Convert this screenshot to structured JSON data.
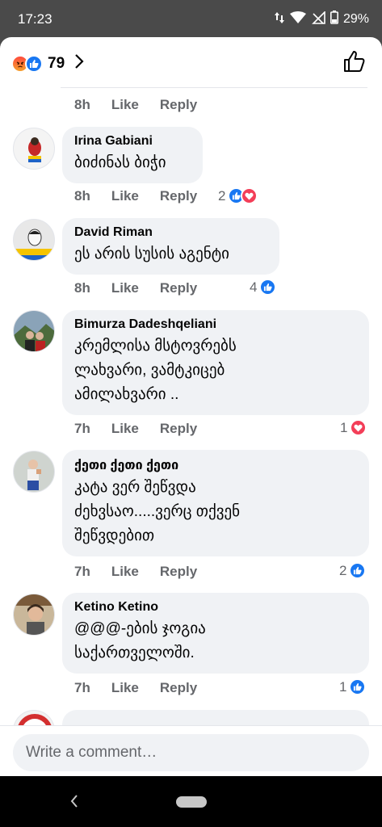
{
  "status_bar": {
    "time": "17:23",
    "battery": "29%"
  },
  "header": {
    "reaction_count": "79"
  },
  "comments": [
    {
      "time": "8h",
      "like": "Like",
      "reply": "Reply"
    },
    {
      "author": "Irina Gabiani",
      "text": "ბიძინას ბიჭი",
      "time": "8h",
      "like": "Like",
      "reply": "Reply",
      "reaction_count": "2"
    },
    {
      "author": "David Riman",
      "text": "ეს არის სუსის აგენტი",
      "time": "8h",
      "like": "Like",
      "reply": "Reply",
      "reaction_count": "4"
    },
    {
      "author": "Bimurza Dadeshqeliani",
      "text": "კრემლისა მსტოვრებს\nლახვარი, ვამტკიცებ\nამილახვარი ..",
      "time": "7h",
      "like": "Like",
      "reply": "Reply",
      "reaction_count": "1"
    },
    {
      "author": "ქეთი ქეთი ქეთი",
      "text": "კატა ვერ შეწვდა\nძეხვსაო.....ვერც თქვენ\nშეწვდებით",
      "time": "7h",
      "like": "Like",
      "reply": "Reply",
      "reaction_count": "2"
    },
    {
      "author": "Ketino Ketino",
      "text": "@@@-ების ჯოგია\nსაქართველოში.",
      "time": "7h",
      "like": "Like",
      "reply": "Reply",
      "reaction_count": "1"
    }
  ],
  "composer": {
    "placeholder": "Write a comment…"
  },
  "colors": {
    "like_blue": "#1877f2",
    "heart_red": "#f33e58",
    "bubble": "#f0f2f5",
    "meta_gray": "#65676b"
  }
}
